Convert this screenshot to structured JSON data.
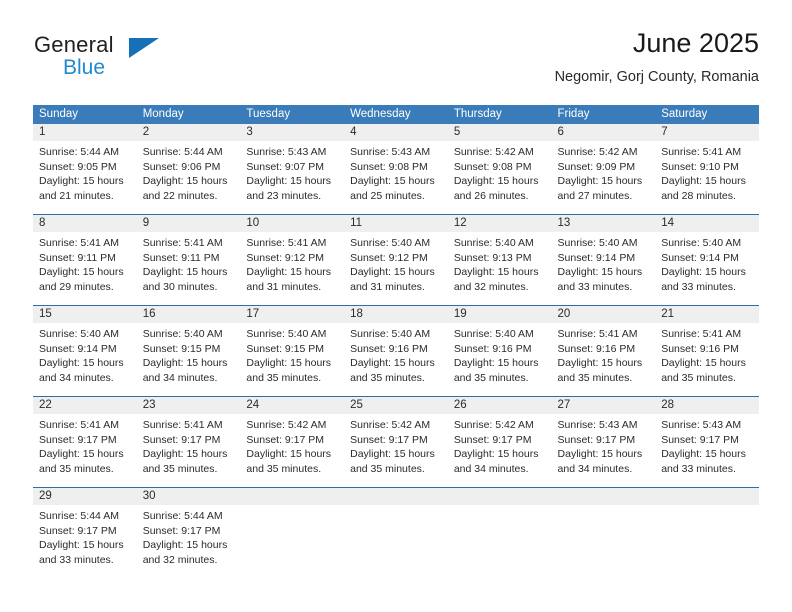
{
  "brand": {
    "name_part1": "General",
    "name_part2": "Blue",
    "logo_icon": "triangle-flag-icon",
    "color_dark": "#231f20",
    "color_blue": "#1f8ad2",
    "color_triangle": "#1670b8"
  },
  "header": {
    "title": "June 2025",
    "subtitle": "Negomir, Gorj County, Romania"
  },
  "theme": {
    "header_blue": "#3a7cb9",
    "row_divider_blue": "#2f6ca8",
    "day_band_gray": "#efefef",
    "text": "#2b2b2b"
  },
  "calendar": {
    "day_headers": [
      "Sunday",
      "Monday",
      "Tuesday",
      "Wednesday",
      "Thursday",
      "Friday",
      "Saturday"
    ],
    "weeks": [
      [
        {
          "day": "1",
          "lines": [
            "Sunrise: 5:44 AM",
            "Sunset: 9:05 PM",
            "Daylight: 15 hours",
            "and 21 minutes."
          ]
        },
        {
          "day": "2",
          "lines": [
            "Sunrise: 5:44 AM",
            "Sunset: 9:06 PM",
            "Daylight: 15 hours",
            "and 22 minutes."
          ]
        },
        {
          "day": "3",
          "lines": [
            "Sunrise: 5:43 AM",
            "Sunset: 9:07 PM",
            "Daylight: 15 hours",
            "and 23 minutes."
          ]
        },
        {
          "day": "4",
          "lines": [
            "Sunrise: 5:43 AM",
            "Sunset: 9:08 PM",
            "Daylight: 15 hours",
            "and 25 minutes."
          ]
        },
        {
          "day": "5",
          "lines": [
            "Sunrise: 5:42 AM",
            "Sunset: 9:08 PM",
            "Daylight: 15 hours",
            "and 26 minutes."
          ]
        },
        {
          "day": "6",
          "lines": [
            "Sunrise: 5:42 AM",
            "Sunset: 9:09 PM",
            "Daylight: 15 hours",
            "and 27 minutes."
          ]
        },
        {
          "day": "7",
          "lines": [
            "Sunrise: 5:41 AM",
            "Sunset: 9:10 PM",
            "Daylight: 15 hours",
            "and 28 minutes."
          ]
        }
      ],
      [
        {
          "day": "8",
          "lines": [
            "Sunrise: 5:41 AM",
            "Sunset: 9:11 PM",
            "Daylight: 15 hours",
            "and 29 minutes."
          ]
        },
        {
          "day": "9",
          "lines": [
            "Sunrise: 5:41 AM",
            "Sunset: 9:11 PM",
            "Daylight: 15 hours",
            "and 30 minutes."
          ]
        },
        {
          "day": "10",
          "lines": [
            "Sunrise: 5:41 AM",
            "Sunset: 9:12 PM",
            "Daylight: 15 hours",
            "and 31 minutes."
          ]
        },
        {
          "day": "11",
          "lines": [
            "Sunrise: 5:40 AM",
            "Sunset: 9:12 PM",
            "Daylight: 15 hours",
            "and 31 minutes."
          ]
        },
        {
          "day": "12",
          "lines": [
            "Sunrise: 5:40 AM",
            "Sunset: 9:13 PM",
            "Daylight: 15 hours",
            "and 32 minutes."
          ]
        },
        {
          "day": "13",
          "lines": [
            "Sunrise: 5:40 AM",
            "Sunset: 9:14 PM",
            "Daylight: 15 hours",
            "and 33 minutes."
          ]
        },
        {
          "day": "14",
          "lines": [
            "Sunrise: 5:40 AM",
            "Sunset: 9:14 PM",
            "Daylight: 15 hours",
            "and 33 minutes."
          ]
        }
      ],
      [
        {
          "day": "15",
          "lines": [
            "Sunrise: 5:40 AM",
            "Sunset: 9:14 PM",
            "Daylight: 15 hours",
            "and 34 minutes."
          ]
        },
        {
          "day": "16",
          "lines": [
            "Sunrise: 5:40 AM",
            "Sunset: 9:15 PM",
            "Daylight: 15 hours",
            "and 34 minutes."
          ]
        },
        {
          "day": "17",
          "lines": [
            "Sunrise: 5:40 AM",
            "Sunset: 9:15 PM",
            "Daylight: 15 hours",
            "and 35 minutes."
          ]
        },
        {
          "day": "18",
          "lines": [
            "Sunrise: 5:40 AM",
            "Sunset: 9:16 PM",
            "Daylight: 15 hours",
            "and 35 minutes."
          ]
        },
        {
          "day": "19",
          "lines": [
            "Sunrise: 5:40 AM",
            "Sunset: 9:16 PM",
            "Daylight: 15 hours",
            "and 35 minutes."
          ]
        },
        {
          "day": "20",
          "lines": [
            "Sunrise: 5:41 AM",
            "Sunset: 9:16 PM",
            "Daylight: 15 hours",
            "and 35 minutes."
          ]
        },
        {
          "day": "21",
          "lines": [
            "Sunrise: 5:41 AM",
            "Sunset: 9:16 PM",
            "Daylight: 15 hours",
            "and 35 minutes."
          ]
        }
      ],
      [
        {
          "day": "22",
          "lines": [
            "Sunrise: 5:41 AM",
            "Sunset: 9:17 PM",
            "Daylight: 15 hours",
            "and 35 minutes."
          ]
        },
        {
          "day": "23",
          "lines": [
            "Sunrise: 5:41 AM",
            "Sunset: 9:17 PM",
            "Daylight: 15 hours",
            "and 35 minutes."
          ]
        },
        {
          "day": "24",
          "lines": [
            "Sunrise: 5:42 AM",
            "Sunset: 9:17 PM",
            "Daylight: 15 hours",
            "and 35 minutes."
          ]
        },
        {
          "day": "25",
          "lines": [
            "Sunrise: 5:42 AM",
            "Sunset: 9:17 PM",
            "Daylight: 15 hours",
            "and 35 minutes."
          ]
        },
        {
          "day": "26",
          "lines": [
            "Sunrise: 5:42 AM",
            "Sunset: 9:17 PM",
            "Daylight: 15 hours",
            "and 34 minutes."
          ]
        },
        {
          "day": "27",
          "lines": [
            "Sunrise: 5:43 AM",
            "Sunset: 9:17 PM",
            "Daylight: 15 hours",
            "and 34 minutes."
          ]
        },
        {
          "day": "28",
          "lines": [
            "Sunrise: 5:43 AM",
            "Sunset: 9:17 PM",
            "Daylight: 15 hours",
            "and 33 minutes."
          ]
        }
      ],
      [
        {
          "day": "29",
          "lines": [
            "Sunrise: 5:44 AM",
            "Sunset: 9:17 PM",
            "Daylight: 15 hours",
            "and 33 minutes."
          ]
        },
        {
          "day": "30",
          "lines": [
            "Sunrise: 5:44 AM",
            "Sunset: 9:17 PM",
            "Daylight: 15 hours",
            "and 32 minutes."
          ]
        },
        {
          "day": "",
          "lines": []
        },
        {
          "day": "",
          "lines": []
        },
        {
          "day": "",
          "lines": []
        },
        {
          "day": "",
          "lines": []
        },
        {
          "day": "",
          "lines": []
        }
      ]
    ]
  }
}
